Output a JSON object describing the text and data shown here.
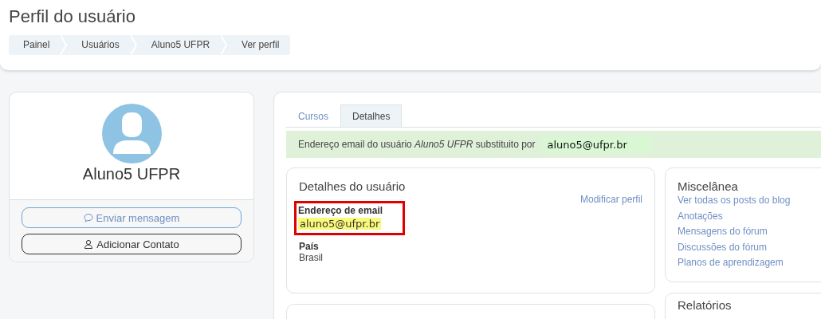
{
  "page_title": "Perfil do usuário",
  "breadcrumb": [
    "Painel",
    "Usuários",
    "Aluno5 UFPR",
    "Ver perfil"
  ],
  "profile": {
    "name": "Aluno5 UFPR",
    "buttons": [
      {
        "kind": "message",
        "label": "Enviar mensagem"
      },
      {
        "kind": "contact",
        "label": "Adicionar Contato"
      }
    ]
  },
  "tabs": [
    {
      "label": "Cursos",
      "selected": false
    },
    {
      "label": "Detalhes",
      "selected": true
    }
  ],
  "alert": {
    "text": "Endereço email do usuário *Aluno5 UFPR* substituito por",
    "value": "aluno5@ufpr.br"
  },
  "user_details": {
    "title": "Detalhes do usuário",
    "edit_link": "Modificar perfil",
    "fields": [
      {
        "label": "Endereço de email",
        "value": "aluno5@ufpr.br",
        "highlighted": true
      },
      {
        "label": "País",
        "value": "Brasil",
        "highlighted": false
      }
    ]
  },
  "misc": {
    "title": "Miscelânea",
    "links": [
      "Ver todas os posts do blog",
      "Anotações",
      "Mensagens do fórum",
      "Discussões do fórum",
      "Planos de aprendizagem"
    ]
  },
  "reports": {
    "title": "Relatórios"
  }
}
